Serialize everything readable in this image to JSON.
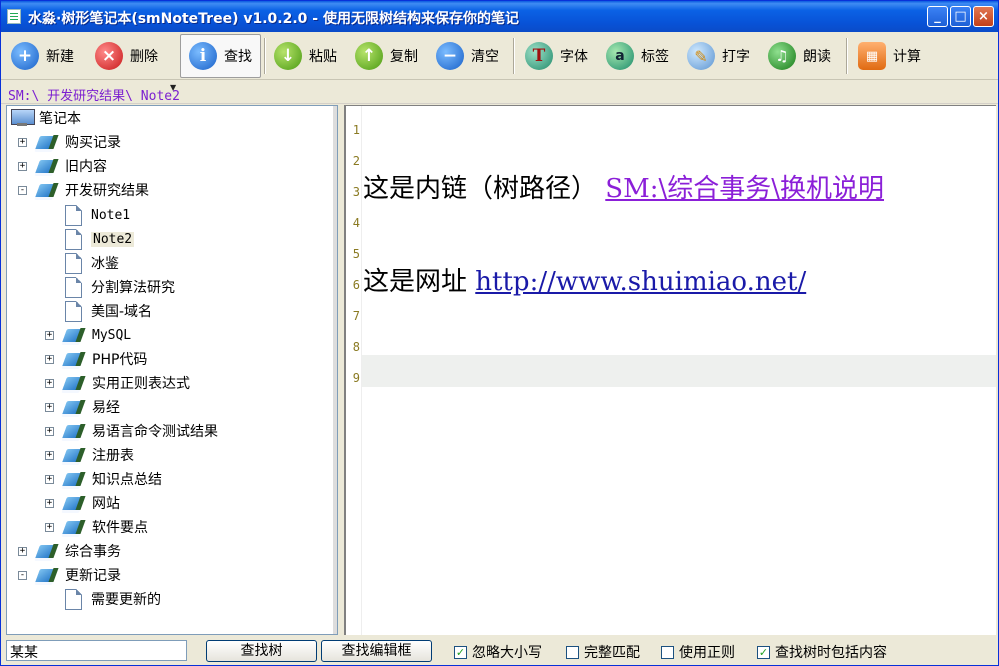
{
  "window": {
    "title": "水淼·树形笔记本(smNoteTree) v1.0.2.0 - 使用无限树结构来保存你的笔记"
  },
  "titlebar_buttons": {
    "minimize": "_",
    "maximize": "□",
    "close": "×"
  },
  "toolbar": {
    "new": "新建",
    "delete": "删除",
    "find": "查找",
    "paste": "粘贴",
    "copy": "复制",
    "clear": "清空",
    "font": "字体",
    "tag": "标签",
    "type": "打字",
    "read": "朗读",
    "calc": "计算"
  },
  "path": "SM:\\ 开发研究结果\\ Note2",
  "tree": {
    "root": "笔记本",
    "nodes": [
      "购买记录",
      "旧内容",
      "开发研究结果"
    ],
    "notes": [
      "Note1",
      "Note2",
      "冰鉴",
      "分割算法研究",
      "美国-域名"
    ],
    "subfolders": [
      "MySQL",
      "PHP代码",
      "实用正则表达式",
      "易经",
      "易语言命令测试结果",
      "注册表",
      "知识点总结",
      "网站",
      "软件要点"
    ],
    "tail": [
      "综合事务",
      "更新记录"
    ],
    "tail_child": "需要更新的",
    "expand_plus": "+",
    "expand_minus": "-"
  },
  "editor": {
    "line_numbers": [
      "1",
      "2",
      "3",
      "4",
      "5",
      "6",
      "7",
      "8",
      "9"
    ],
    "line3_text": "这是内链（树路径）",
    "line3_link": "SM:\\综合事务\\换机说明",
    "line6_text": "这是网址",
    "line6_link": "http://www.shuimiao.net/"
  },
  "status": {
    "search_value": "某某",
    "find_tree": "查找树",
    "find_editor": "查找编辑框",
    "ignore_case": "忽略大小写",
    "whole_match": "完整匹配",
    "use_regex": "使用正则",
    "include_content": "查找树时包括内容",
    "check_mark": "✓"
  },
  "colors": {
    "title_bar": "#0a5ae0",
    "link_purple": "#8b1fd8",
    "link_blue": "#1a1aa8",
    "path_text": "#7b1fd0"
  }
}
